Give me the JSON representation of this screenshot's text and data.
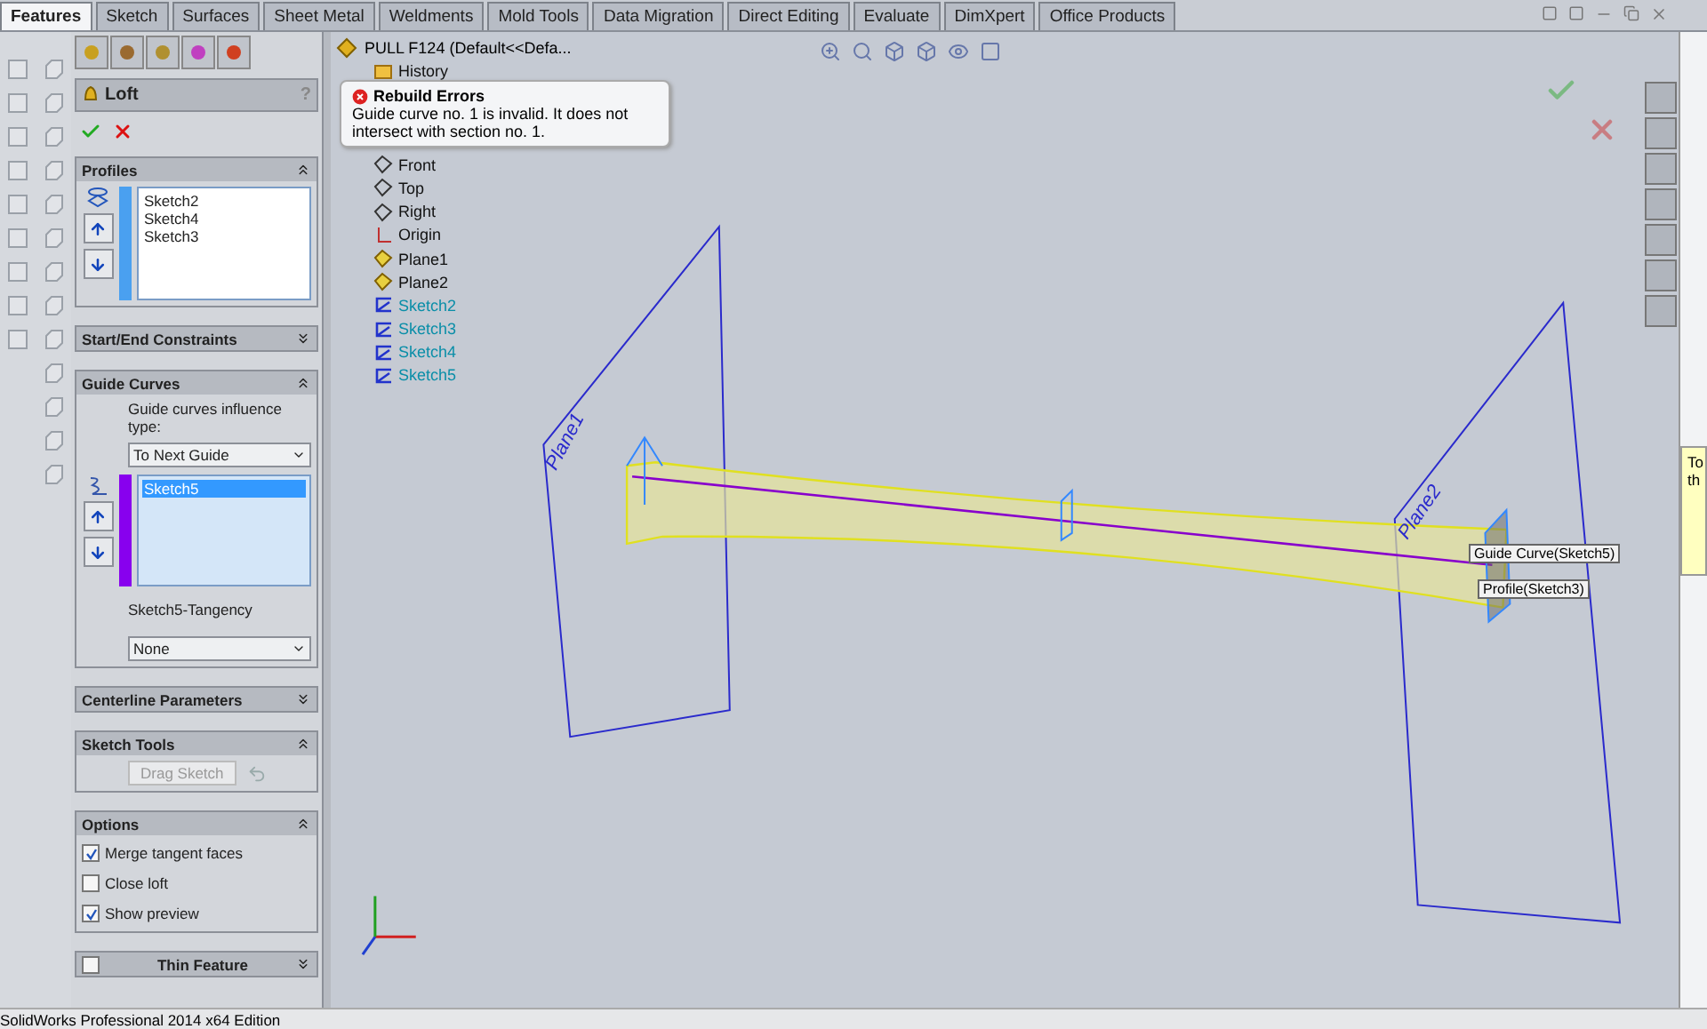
{
  "command_tabs": [
    {
      "label": "Features",
      "selected": true
    },
    {
      "label": "Sketch",
      "selected": false
    },
    {
      "label": "Surfaces",
      "selected": false
    },
    {
      "label": "Sheet Metal",
      "selected": false
    },
    {
      "label": "Weldments",
      "selected": false
    },
    {
      "label": "Mold Tools",
      "selected": false
    },
    {
      "label": "Data Migration",
      "selected": false
    },
    {
      "label": "Direct Editing",
      "selected": false
    },
    {
      "label": "Evaluate",
      "selected": false
    },
    {
      "label": "DimXpert",
      "selected": false
    },
    {
      "label": "Office Products",
      "selected": false
    }
  ],
  "property_manager": {
    "title": "Loft",
    "help": "?",
    "profiles": {
      "title": "Profiles",
      "expanded": true,
      "items": [
        "Sketch2",
        "Sketch4",
        "Sketch3"
      ]
    },
    "start_end_constraints": {
      "title": "Start/End Constraints",
      "expanded": false
    },
    "guide_curves": {
      "title": "Guide Curves",
      "expanded": true,
      "influence_label": "Guide curves influence type:",
      "influence_value": "To Next Guide",
      "items": [
        {
          "label": "Sketch5",
          "selected": true
        }
      ],
      "tangency_label": "Sketch5-Tangency",
      "tangency_value": "None"
    },
    "centerline_parameters": {
      "title": "Centerline Parameters",
      "expanded": false
    },
    "sketch_tools": {
      "title": "Sketch Tools",
      "expanded": true,
      "drag_button": {
        "label": "Drag Sketch",
        "disabled": true
      }
    },
    "options": {
      "title": "Options",
      "expanded": true,
      "checkboxes": [
        {
          "label": "Merge tangent faces",
          "checked": true
        },
        {
          "label": "Close loft",
          "checked": false
        },
        {
          "label": "Show preview",
          "checked": true
        }
      ]
    },
    "thin_feature": {
      "title": "Thin Feature",
      "expanded": false,
      "checked": false
    }
  },
  "feature_tree": {
    "root": "PULL F124  (Default<<Defa...",
    "items": [
      {
        "label": "History",
        "kind": "folder",
        "highlighted": false
      },
      {
        "label": "Front",
        "kind": "plane",
        "highlighted": false
      },
      {
        "label": "Top",
        "kind": "plane",
        "highlighted": false
      },
      {
        "label": "Right",
        "kind": "plane",
        "highlighted": false
      },
      {
        "label": "Origin",
        "kind": "origin",
        "highlighted": false
      },
      {
        "label": "Plane1",
        "kind": "ref-plane",
        "highlighted": false
      },
      {
        "label": "Plane2",
        "kind": "ref-plane",
        "highlighted": false
      },
      {
        "label": "Sketch2",
        "kind": "sketch",
        "highlighted": true
      },
      {
        "label": "Sketch3",
        "kind": "sketch",
        "highlighted": true
      },
      {
        "label": "Sketch4",
        "kind": "sketch",
        "highlighted": true
      },
      {
        "label": "Sketch5",
        "kind": "sketch",
        "highlighted": true
      }
    ]
  },
  "error_tooltip": {
    "title": "Rebuild Errors",
    "message": "Guide curve no. 1 is invalid. It does not intersect with section no. 1."
  },
  "viewport": {
    "plane_labels": [
      "Plane1",
      "Plane2"
    ],
    "callouts": [
      "Guide Curve(Sketch5)",
      "Profile(Sketch3)"
    ]
  },
  "side_tooltip": {
    "lines": [
      "To",
      "th"
    ]
  },
  "status_bar": {
    "text": "SolidWorks Professional 2014 x64 Edition"
  }
}
